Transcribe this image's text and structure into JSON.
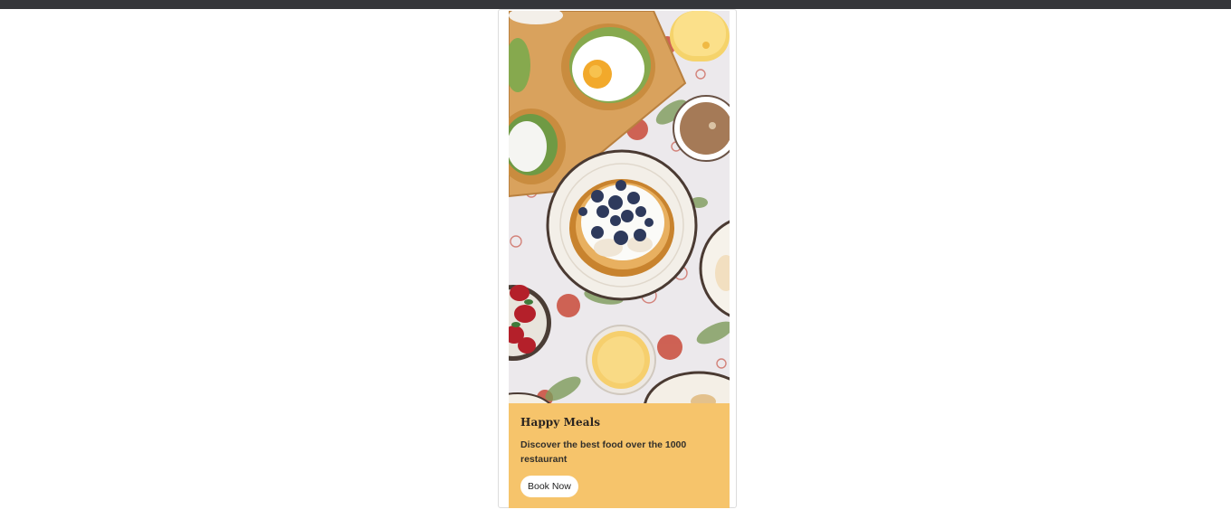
{
  "card": {
    "title": "Happy Meals",
    "description": "Discover the best food over the 1000 restaurant",
    "button_label": "Book Now",
    "image_icon": "breakfast-table-photo"
  },
  "colors": {
    "card_body_bg": "#f6c46b",
    "browser_bar": "#35363a",
    "button_bg": "#ffffff"
  }
}
